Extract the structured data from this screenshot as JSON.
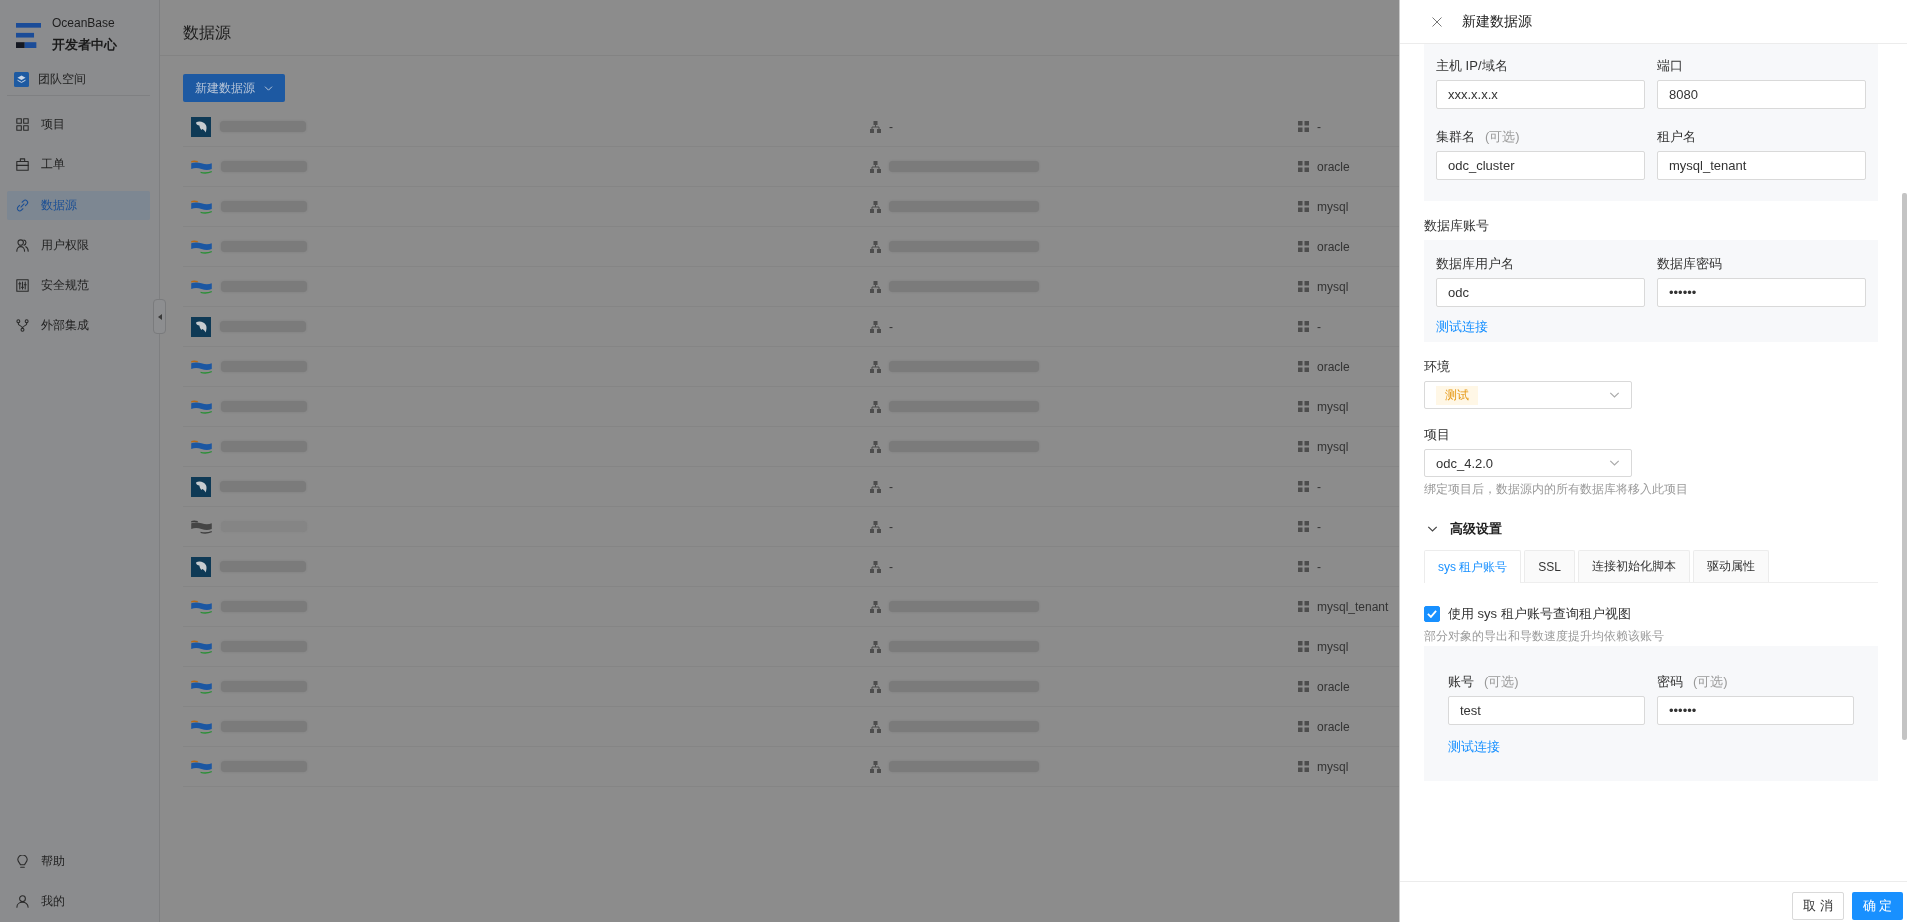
{
  "sidebar": {
    "brand": "OceanBase",
    "subtitle": "开发者中心",
    "workspace": "团队空间",
    "items": [
      {
        "label": "项目",
        "selected": false
      },
      {
        "label": "工单",
        "selected": false
      },
      {
        "label": "数据源",
        "selected": true
      },
      {
        "label": "用户权限",
        "selected": false
      },
      {
        "label": "安全规范",
        "selected": false
      },
      {
        "label": "外部集成",
        "selected": false
      }
    ],
    "footer_items": [
      {
        "label": "帮助"
      },
      {
        "label": "我的"
      }
    ]
  },
  "page": {
    "title": "数据源",
    "create_button": "新建数据源",
    "rows": [
      {
        "kind": "mysql",
        "disabled": false,
        "cluster": "-",
        "tenant": "-"
      },
      {
        "kind": "oceanbase",
        "disabled": false,
        "tenant": "oracle"
      },
      {
        "kind": "oceanbase",
        "disabled": false,
        "tenant": "mysql"
      },
      {
        "kind": "oceanbase",
        "disabled": false,
        "tenant": "oracle"
      },
      {
        "kind": "oceanbase",
        "disabled": false,
        "tenant": "mysql"
      },
      {
        "kind": "mysql",
        "disabled": false,
        "cluster": "-",
        "tenant": "-"
      },
      {
        "kind": "oceanbase",
        "disabled": false,
        "tenant": "oracle"
      },
      {
        "kind": "oceanbase",
        "disabled": false,
        "tenant": "mysql"
      },
      {
        "kind": "oceanbase",
        "disabled": false,
        "tenant": "mysql"
      },
      {
        "kind": "mysql",
        "disabled": false,
        "cluster": "-",
        "tenant": "-"
      },
      {
        "kind": "oceanbase",
        "disabled": true,
        "cluster": "-",
        "tenant": "-"
      },
      {
        "kind": "mysql",
        "disabled": false,
        "cluster": "-",
        "tenant": "-"
      },
      {
        "kind": "oceanbase",
        "disabled": false,
        "tenant": "mysql_tenant"
      },
      {
        "kind": "oceanbase",
        "disabled": false,
        "tenant": "mysql"
      },
      {
        "kind": "oceanbase",
        "disabled": false,
        "tenant": "oracle"
      },
      {
        "kind": "oceanbase",
        "disabled": false,
        "tenant": "oracle"
      },
      {
        "kind": "oceanbase",
        "disabled": false,
        "tenant": "mysql"
      }
    ]
  },
  "drawer": {
    "title": "新建数据源",
    "connection_fields": [
      {
        "label": "主机 IP/域名",
        "value": "xxx.x.x.x"
      },
      {
        "label": "端口",
        "value": "8080"
      },
      {
        "label": "集群名",
        "optional": "(可选)",
        "value": "odc_cluster"
      },
      {
        "label": "租户名",
        "value": "mysql_tenant"
      }
    ],
    "account": {
      "heading": "数据库账号",
      "fields": [
        {
          "label": "数据库用户名",
          "value": "odc"
        },
        {
          "label": "数据库密码",
          "value": "••••••"
        }
      ],
      "test_link": "测试连接"
    },
    "environment": {
      "label": "环境",
      "tag": "测试"
    },
    "project": {
      "label": "项目",
      "value": "odc_4.2.0",
      "help": "绑定项目后，数据源内的所有数据库将移入此项目"
    },
    "advanced": {
      "label": "高级设置",
      "expanded": true,
      "tabs": [
        {
          "label": "sys 租户账号",
          "selected": true
        },
        {
          "label": "SSL",
          "selected": false
        },
        {
          "label": "连接初始化脚本",
          "selected": false
        },
        {
          "label": "驱动属性",
          "selected": false
        }
      ],
      "sys_account": {
        "checkbox": {
          "label": "使用 sys 租户账号查询租户视图",
          "checked": true
        },
        "help": "部分对象的导出和导数速度提升均依赖该账号",
        "fields": [
          {
            "label": "账号",
            "optional": "(可选)",
            "value": "test"
          },
          {
            "label": "密码",
            "optional": "(可选)",
            "value": "••••••"
          }
        ],
        "test_link": "测试连接"
      }
    },
    "footer": {
      "cancel": "取 消",
      "confirm": "确 定"
    }
  }
}
